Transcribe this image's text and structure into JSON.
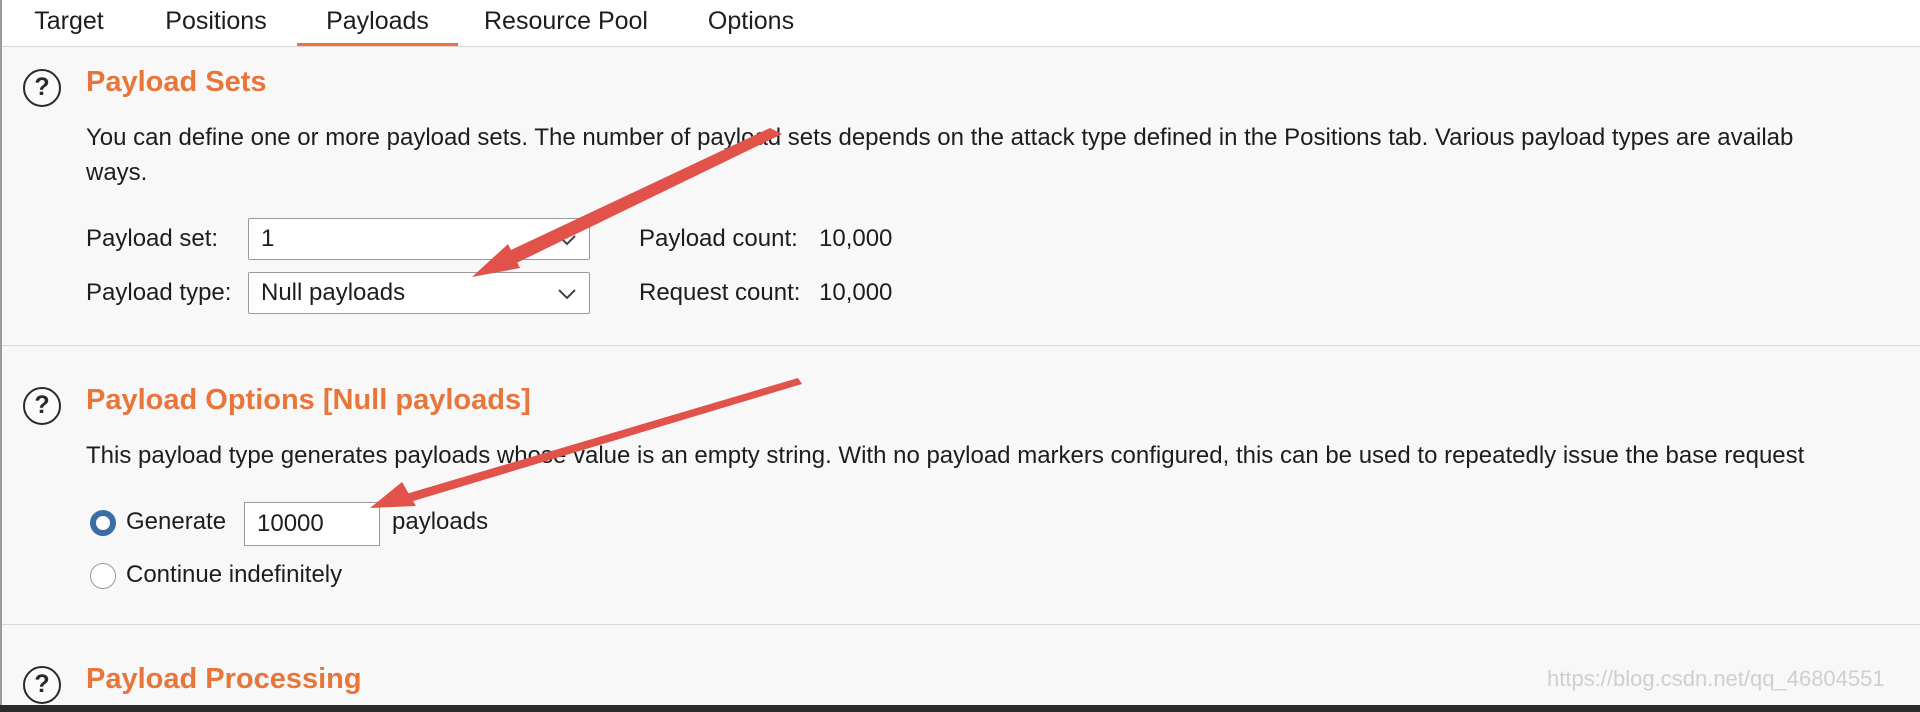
{
  "tabs": [
    {
      "label": "Target"
    },
    {
      "label": "Positions"
    },
    {
      "label": "Payloads",
      "active": true
    },
    {
      "label": "Resource Pool"
    },
    {
      "label": "Options"
    }
  ],
  "payload_sets": {
    "title": "Payload Sets",
    "description_line1": "You can define one or more payload sets. The number of payload sets depends on the attack type defined in the Positions tab. Various payload types are availab",
    "description_line2": "ways.",
    "set_label": "Payload set:",
    "set_value": "1",
    "type_label": "Payload type:",
    "type_value": "Null payloads",
    "payload_count_label": "Payload count:",
    "payload_count_value": "10,000",
    "request_count_label": "Request count:",
    "request_count_value": "10,000"
  },
  "payload_options": {
    "title": "Payload Options [Null payloads]",
    "description": "This payload type generates payloads whose value is an empty string. With no payload markers configured, this can be used to repeatedly issue the base request",
    "generate_label": "Generate",
    "generate_value": "10000",
    "generate_suffix": "payloads",
    "continue_label": "Continue indefinitely",
    "selected": "generate"
  },
  "payload_processing": {
    "title": "Payload Processing"
  },
  "help_icon_glyph": "?",
  "watermark": "https://blog.csdn.net/qq_46804551",
  "colors": {
    "accent": "#e8763b",
    "annotation_arrow": "#e0524a",
    "radio_selected": "#3b6ea5"
  }
}
